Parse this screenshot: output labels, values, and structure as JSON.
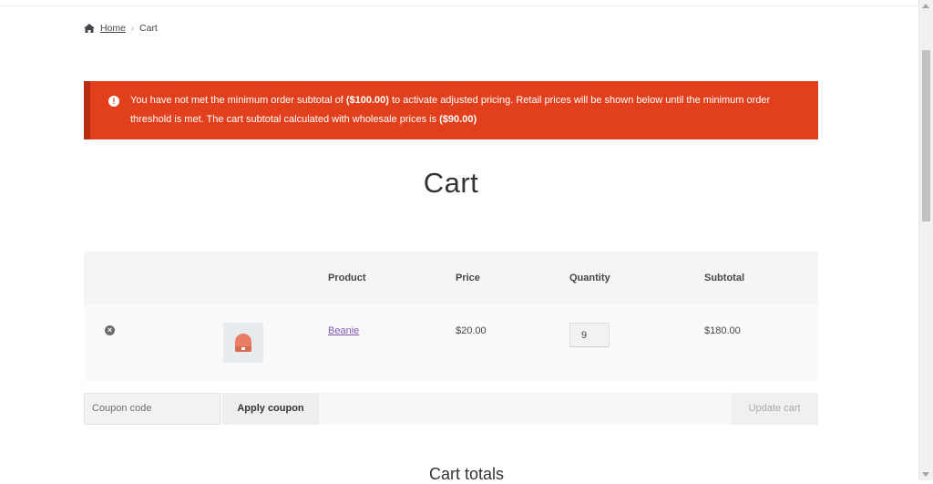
{
  "breadcrumb": {
    "home_label": "Home",
    "separator": "›",
    "current": "Cart"
  },
  "notice": {
    "text_before_min": "You have not met the minimum order subtotal of ",
    "min_amount": "($100.00)",
    "text_after_min": " to activate adjusted pricing. Retail prices will be shown below until the minimum order threshold is met. The cart subtotal calculated with wholesale prices is ",
    "wholesale_amount": "($90.00)",
    "icon": "alert-icon",
    "color": "#e2401c"
  },
  "page": {
    "title": "Cart"
  },
  "cart_table": {
    "headers": {
      "product": "Product",
      "price": "Price",
      "quantity": "Quantity",
      "subtotal": "Subtotal"
    },
    "rows": [
      {
        "remove_icon": "remove-icon",
        "thumbnail": "beanie-thumbnail",
        "product": "Beanie",
        "price": "$20.00",
        "quantity": "9",
        "subtotal": "$180.00"
      }
    ]
  },
  "actions": {
    "coupon_placeholder": "Coupon code",
    "apply_label": "Apply coupon",
    "update_label": "Update cart"
  },
  "totals": {
    "title": "Cart totals"
  },
  "colors": {
    "accent_link": "#7f54b3",
    "notice_bg": "#e2401c"
  }
}
